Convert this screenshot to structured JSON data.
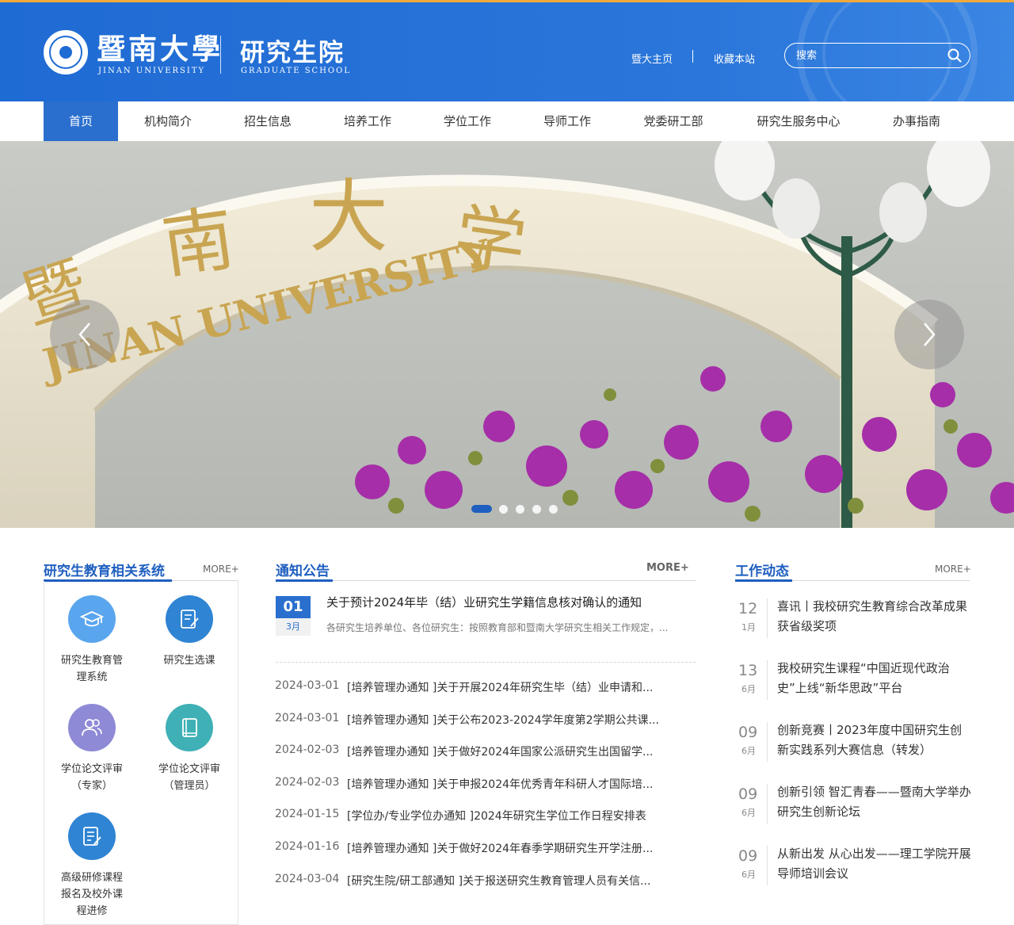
{
  "header": {
    "logo_cn": "暨南大學",
    "logo_en": "JINAN UNIVERSITY",
    "school_cn": "研究生院",
    "school_en": "GRADUATE SCHOOL",
    "links": [
      "暨大主页",
      "收藏本站"
    ],
    "search_placeholder": "搜索",
    "colors": {
      "header_blue": "#2a6fce",
      "accent_orange": "#f0a93a"
    }
  },
  "nav": {
    "items": [
      "首页",
      "机构简介",
      "招生信息",
      "培养工作",
      "学位工作",
      "导师工作",
      "党委研工部",
      "研究生服务中心",
      "办事指南"
    ],
    "active_index": 0
  },
  "banner": {
    "slide_count": 5,
    "active_slide": 0,
    "prev_icon": "chevron-left-icon",
    "next_icon": "chevron-right-icon"
  },
  "systems": {
    "title": "研究生教育相关系统",
    "more": "MORE+",
    "items": [
      {
        "label_lines": [
          "研究生教育管",
          "理系统"
        ],
        "icon": "graduation-cap-icon",
        "color": "#5aa6ee"
      },
      {
        "label_lines": [
          "研究生选课"
        ],
        "icon": "edit-document-icon",
        "color": "#2f84d3"
      },
      {
        "label_lines": [
          "学位论文评审",
          "（专家）"
        ],
        "icon": "users-icon",
        "color": "#8e8ad6"
      },
      {
        "label_lines": [
          "学位论文评审",
          "（管理员）"
        ],
        "icon": "book-icon",
        "color": "#3fb0b5"
      },
      {
        "label_lines": [
          "高级研修课程",
          "报名及校外课",
          "程进修"
        ],
        "icon": "form-icon",
        "color": "#2f84d3"
      }
    ]
  },
  "notices": {
    "title": "通知公告",
    "more": "MORE+",
    "featured": {
      "day": "01",
      "month": "3月",
      "title": "关于预计2024年毕（结）业研究生学籍信息核对确认的通知",
      "desc": "各研究生培养单位、各位研究生：按照教育部和暨南大学研究生相关工作规定，..."
    },
    "items": [
      {
        "date": "2024-03-01",
        "text": "[培养管理办通知 ]关于开展2024年研究生毕（结）业申请和..."
      },
      {
        "date": "2024-03-01",
        "text": "[培养管理办通知 ]关于公布2023-2024学年度第2学期公共课..."
      },
      {
        "date": "2024-02-03",
        "text": "[培养管理办通知 ]关于做好2024年国家公派研究生出国留学..."
      },
      {
        "date": "2024-02-03",
        "text": "[培养管理办通知 ]关于申报2024年优秀青年科研人才国际培..."
      },
      {
        "date": "2024-01-15",
        "text": "[学位办/专业学位办通知 ]2024年研究生学位工作日程安排表"
      },
      {
        "date": "2024-01-16",
        "text": "[培养管理办通知 ]关于做好2024年春季学期研究生开学注册..."
      },
      {
        "date": "2024-03-04",
        "text": "[研究生院/研工部通知 ]关于报送研究生教育管理人员有关信..."
      }
    ]
  },
  "news": {
    "title": "工作动态",
    "more": "MORE+",
    "items": [
      {
        "day": "12",
        "month": "1月",
        "text": "喜讯丨我校研究生教育综合改革成果获省级奖项"
      },
      {
        "day": "13",
        "month": "6月",
        "text": "我校研究生课程“中国近现代政治史”上线“新华思政”平台"
      },
      {
        "day": "09",
        "month": "6月",
        "text": "创新竞赛丨2023年度中国研究生创新实践系列大赛信息（转发）"
      },
      {
        "day": "09",
        "month": "6月",
        "text": "创新引领 智汇青春——暨南大学举办研究生创新论坛"
      },
      {
        "day": "09",
        "month": "6月",
        "text": "从新出发 从心出发——理工学院开展导师培训会议"
      }
    ]
  }
}
